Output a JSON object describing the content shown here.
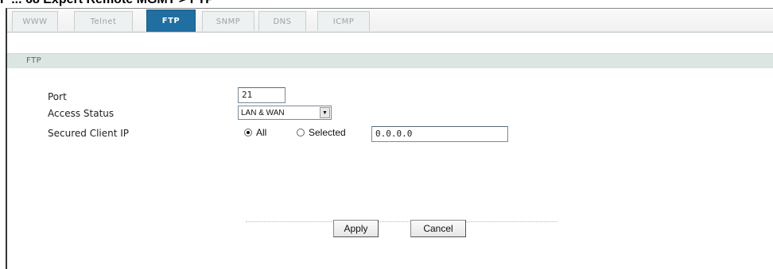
{
  "caption": "F ... 68   Expert Remote MGMT > FTP",
  "tabs": [
    {
      "label": "WWW",
      "active": false
    },
    {
      "label": "Telnet",
      "active": false
    },
    {
      "label": "FTP",
      "active": true
    },
    {
      "label": "SNMP",
      "active": false
    },
    {
      "label": "DNS",
      "active": false
    },
    {
      "label": "ICMP",
      "active": false
    }
  ],
  "section": {
    "title": "FTP"
  },
  "fields": {
    "port": {
      "label": "Port",
      "value": "21"
    },
    "access_status": {
      "label": "Access Status",
      "value": "LAN & WAN"
    },
    "secured_client_ip": {
      "label": "Secured Client IP",
      "option_all": "All",
      "option_selected": "Selected",
      "selected_value": "all",
      "ip_value": "0.0.0.0"
    }
  },
  "buttons": {
    "apply": "Apply",
    "cancel": "Cancel"
  },
  "colors": {
    "active_tab": "#1f6fa2",
    "section_bar": "#dbe5e1"
  }
}
